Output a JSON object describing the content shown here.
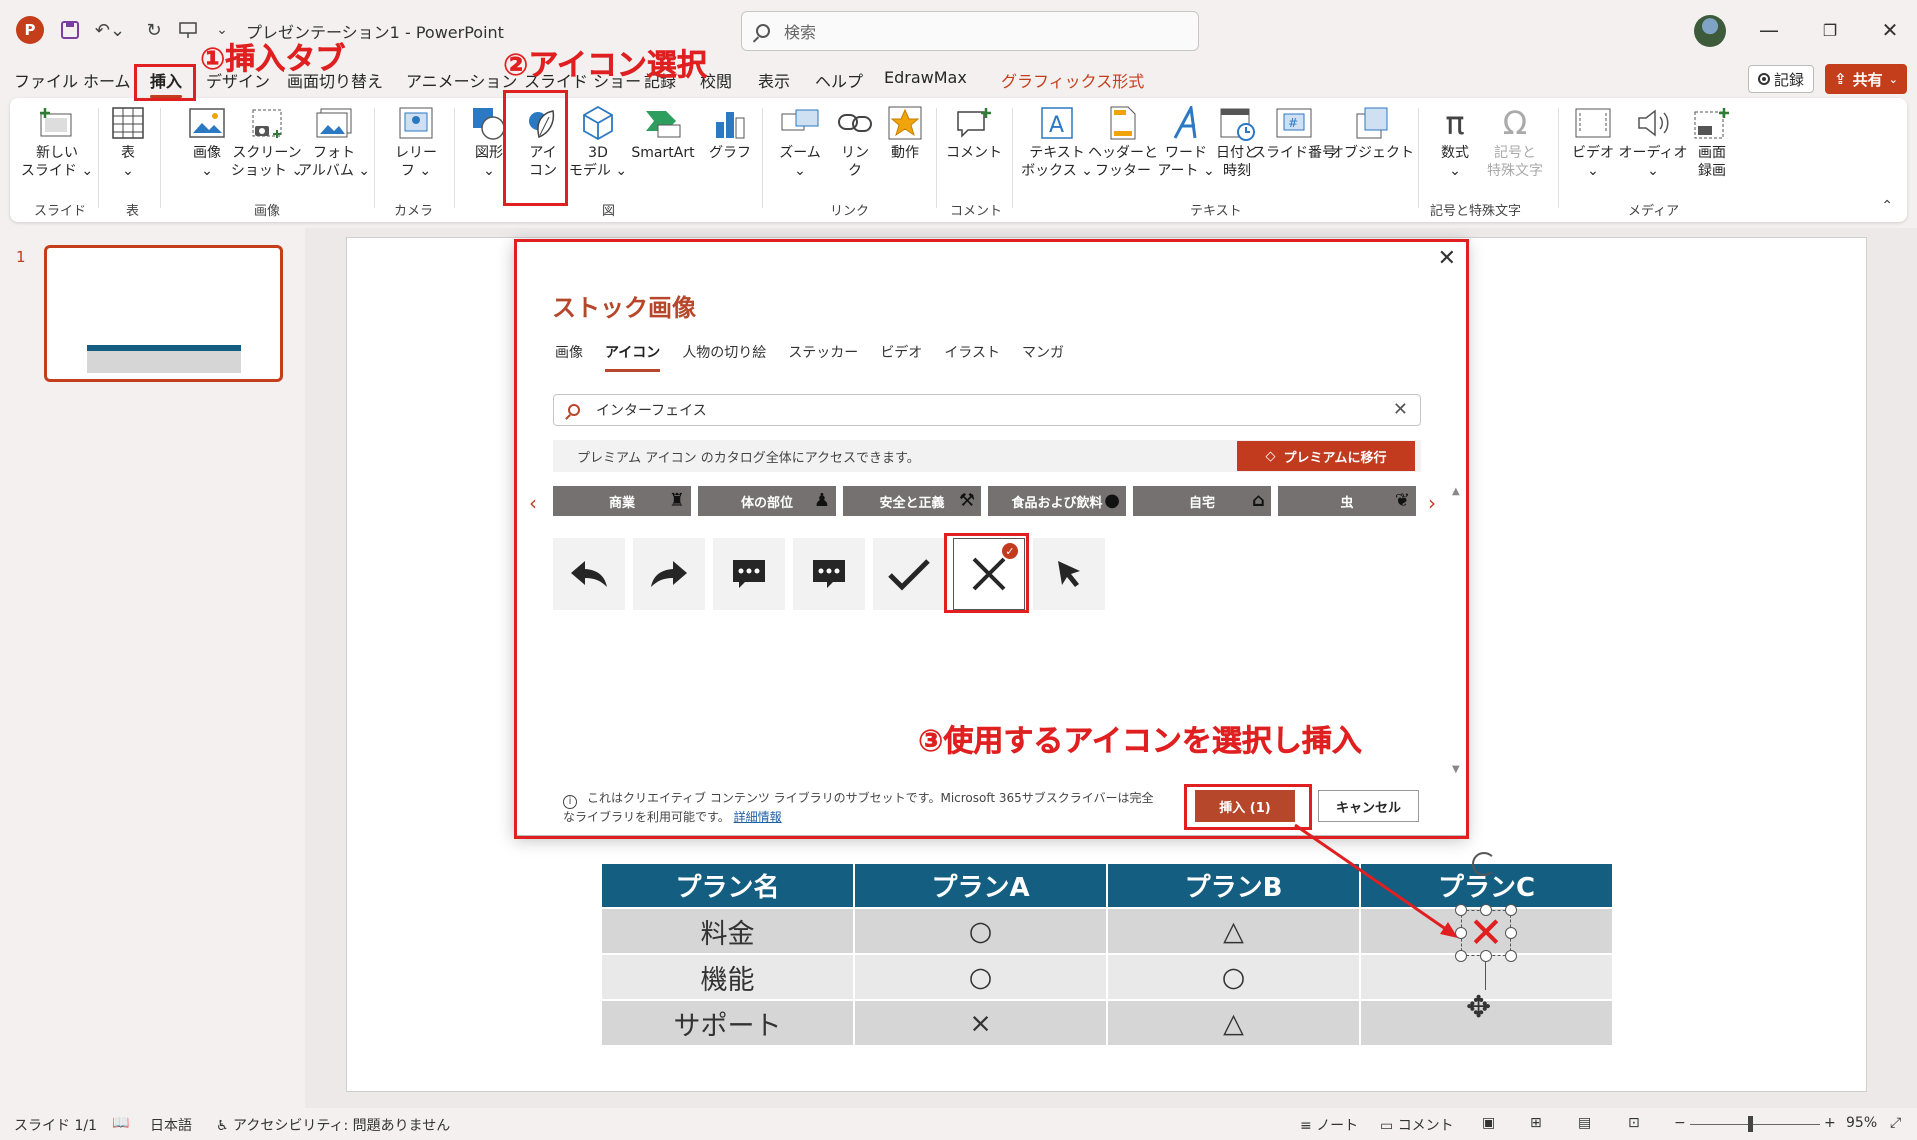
{
  "titlebar": {
    "app_icon": "P",
    "filename": "プレゼンテーション1",
    "separator": "-",
    "app_name": "PowerPoint",
    "search_placeholder": "検索",
    "minimize": "—",
    "maximize": "❐",
    "close": "✕"
  },
  "menu": {
    "tabs": [
      "ファイル",
      "ホーム",
      "挿入",
      "デザイン",
      "画面切り替え",
      "アニメーション",
      "スライド ショー",
      "記録",
      "校閲",
      "表示",
      "ヘルプ",
      "EdrawMax",
      "グラフィックス形式"
    ],
    "active_tab": "挿入",
    "record_label": "記録",
    "share_label": "共有"
  },
  "ribbon": {
    "buttons": [
      {
        "label": "新しい\nスライド ⌄",
        "icon": "new-slide-icon"
      },
      {
        "label": "表\n⌄",
        "icon": "table-icon"
      },
      {
        "label": "画像\n⌄",
        "icon": "picture-icon"
      },
      {
        "label": "スクリーン\nショット ⌄",
        "icon": "screenshot-icon"
      },
      {
        "label": "フォト\nアルバム ⌄",
        "icon": "photo-album-icon"
      },
      {
        "label": "レリー\nフ ⌄",
        "icon": "cameo-icon"
      },
      {
        "label": "図形\n⌄",
        "icon": "shapes-icon"
      },
      {
        "label": "アイ\nコン",
        "icon": "icons-icon"
      },
      {
        "label": "3D\nモデル ⌄",
        "icon": "3d-model-icon"
      },
      {
        "label": "SmartArt",
        "icon": "smartart-icon"
      },
      {
        "label": "グラフ",
        "icon": "chart-icon"
      },
      {
        "label": "ズーム\n⌄",
        "icon": "zoom-icon"
      },
      {
        "label": "リン\nク",
        "icon": "link-icon"
      },
      {
        "label": "動作",
        "icon": "action-icon"
      },
      {
        "label": "コメント",
        "icon": "comment-icon"
      },
      {
        "label": "テキスト\nボックス ⌄",
        "icon": "textbox-icon"
      },
      {
        "label": "ヘッダーと\nフッター",
        "icon": "header-footer-icon"
      },
      {
        "label": "ワード\nアート ⌄",
        "icon": "wordart-icon"
      },
      {
        "label": "日付と\n時刻",
        "icon": "datetime-icon"
      },
      {
        "label": "スライド番号",
        "icon": "slide-number-icon"
      },
      {
        "label": "オブジェクト",
        "icon": "object-icon"
      },
      {
        "label": "数式\n⌄",
        "icon": "equation-icon"
      },
      {
        "label": "記号と\n特殊文字",
        "icon": "symbol-icon"
      },
      {
        "label": "ビデオ\n⌄",
        "icon": "video-icon"
      },
      {
        "label": "オーディオ\n⌄",
        "icon": "audio-icon"
      },
      {
        "label": "画面\n録画",
        "icon": "screen-record-icon"
      }
    ],
    "groups": [
      "スライド",
      "表",
      "画像",
      "カメラ",
      "図",
      "リンク",
      "コメント",
      "テキスト",
      "記号と特殊文字",
      "メディア"
    ]
  },
  "slides_panel": {
    "slide_number": "1"
  },
  "dialog": {
    "title": "ストック画像",
    "tabs": [
      "画像",
      "アイコン",
      "人物の切り絵",
      "ステッカー",
      "ビデオ",
      "イラスト",
      "マンガ"
    ],
    "active_tab": "アイコン",
    "search_value": "インターフェイス",
    "premium_text": "プレミアム アイコン のカタログ全体にアクセスできます。",
    "premium_button": "プレミアムに移行",
    "categories": [
      {
        "label": "商業",
        "icon": "business-icon"
      },
      {
        "label": "体の部位",
        "icon": "body-icon"
      },
      {
        "label": "安全と正義",
        "icon": "gavel-icon"
      },
      {
        "label": "食品および飲料",
        "icon": "food-icon"
      },
      {
        "label": "自宅",
        "icon": "home-icon"
      },
      {
        "label": "虫",
        "icon": "butterfly-icon"
      }
    ],
    "icons": [
      {
        "name": "undo-arrow-icon",
        "glyph": "↶"
      },
      {
        "name": "redo-arrow-icon",
        "glyph": "↷"
      },
      {
        "name": "chat-bubble-icon",
        "glyph": "…"
      },
      {
        "name": "chat-bubble-alt-icon",
        "glyph": "…"
      },
      {
        "name": "checkmark-icon",
        "glyph": "✔"
      },
      {
        "name": "x-mark-icon",
        "glyph": "✕",
        "selected": true
      },
      {
        "name": "cursor-arrow-icon",
        "glyph": "➤"
      }
    ],
    "footer_text": "これはクリエイティブ コンテンツ ライブラリのサブセットです。Microsoft 365サブスクライバーは完全なライブラリを利用可能です。",
    "footer_link": "詳細情報",
    "insert_button": "挿入 (1)",
    "cancel_button": "キャンセル"
  },
  "slide_table": {
    "headers": [
      "プラン名",
      "プランA",
      "プランB",
      "プランC"
    ],
    "rows": [
      [
        "料金",
        "○",
        "△",
        ""
      ],
      [
        "機能",
        "○",
        "○",
        ""
      ],
      [
        "サポート",
        "×",
        "△",
        ""
      ]
    ]
  },
  "annotations": {
    "step1": "①挿入タブ",
    "step2": "②アイコン選択",
    "step3": "③使用するアイコンを選択し挿入"
  },
  "statusbar": {
    "slide_info": "スライド 1/1",
    "language": "日本語",
    "accessibility": "アクセシビリティ: 問題ありません",
    "notes": "ノート",
    "comments": "コメント",
    "zoom": "95%"
  },
  "colors": {
    "accent": "#c43e1c",
    "table_header": "#135e81",
    "annotation": "#e02020"
  }
}
